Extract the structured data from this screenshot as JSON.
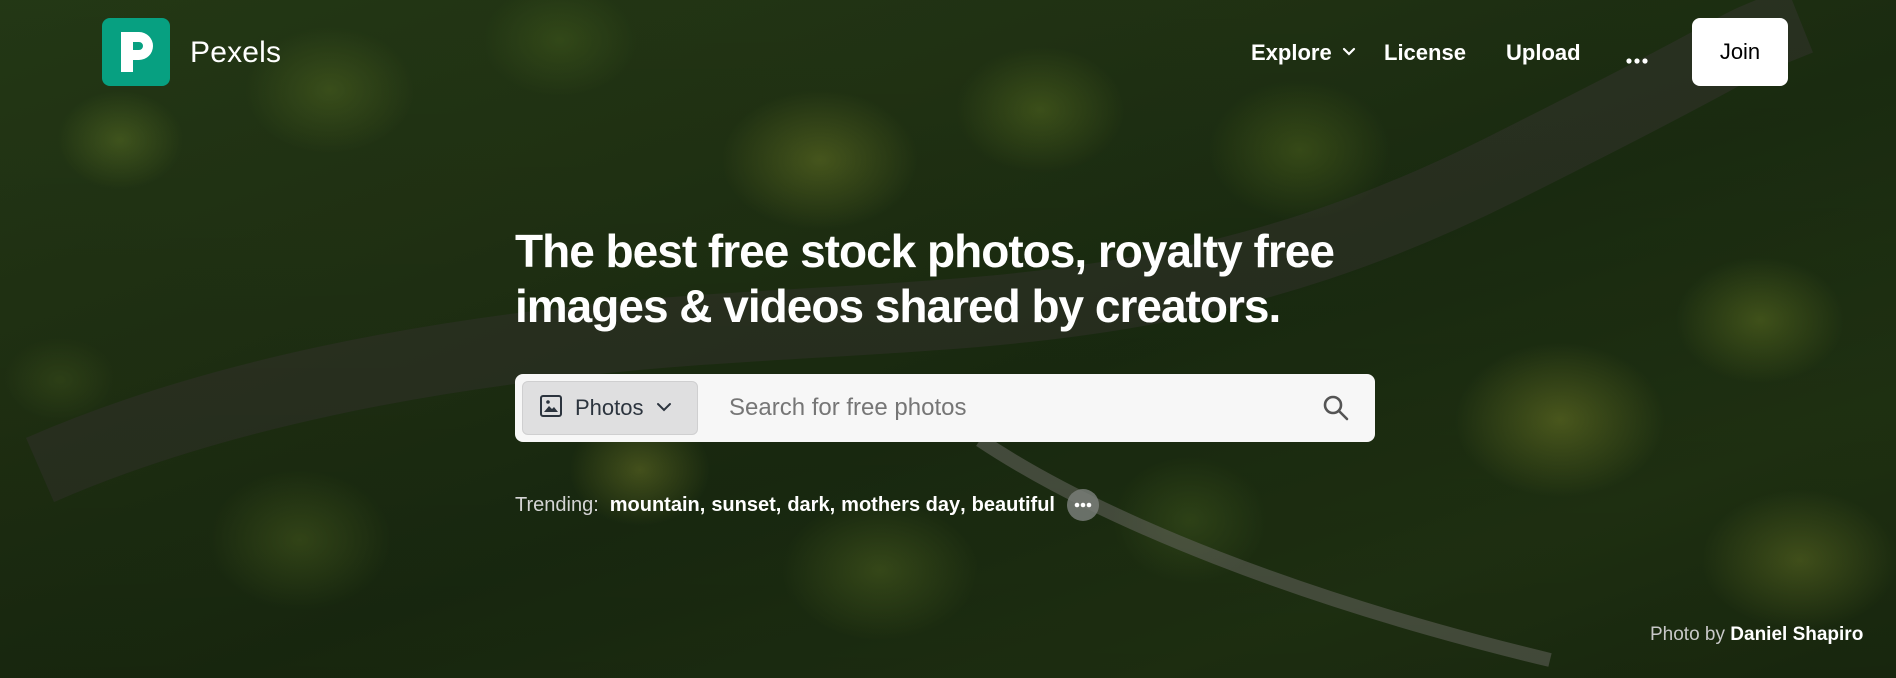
{
  "brand": {
    "name": "Pexels",
    "accent_color": "#07a081",
    "icon": "pexels-logo-icon"
  },
  "nav": {
    "explore": "Explore",
    "license": "License",
    "upload": "Upload",
    "more_icon": "more-dots-icon",
    "join": "Join"
  },
  "hero": {
    "headline": "The best free stock photos, royalty free images & videos shared by creators."
  },
  "search": {
    "type_label": "Photos",
    "type_icon": "image-icon",
    "placeholder": "Search for free photos",
    "value": ""
  },
  "trending": {
    "label": "Trending:",
    "tags": [
      "mountain",
      "sunset",
      "dark",
      "mothers day",
      "beautiful"
    ],
    "more_icon": "more-dots-icon"
  },
  "credit": {
    "prefix": "Photo by",
    "photographer": "Daniel Shapiro"
  }
}
